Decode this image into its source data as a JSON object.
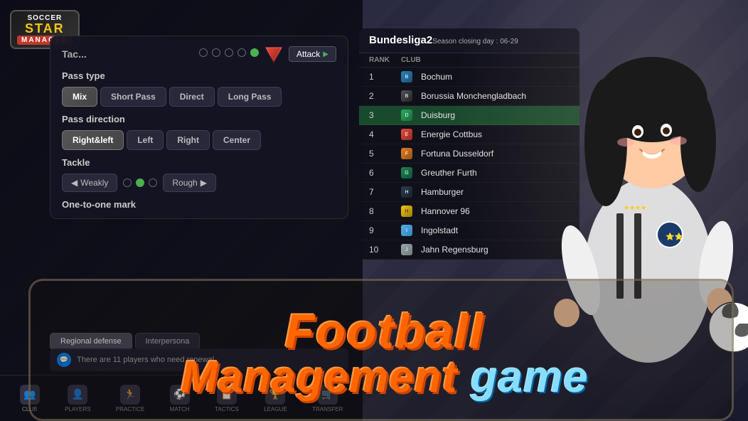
{
  "logo": {
    "line1": "SOCCER",
    "line2": "STAR",
    "line3": "MANAGER"
  },
  "tactics": {
    "title": "Tac...",
    "attack_label": "Attack",
    "pass_type_label": "Pass type",
    "pass_buttons": [
      "Mix",
      "Short Pass",
      "Direct",
      "Long Pass"
    ],
    "pass_direction_label": "Pass direction",
    "direction_buttons": [
      "Right&left",
      "Left",
      "Right",
      "Center"
    ],
    "tackle_label": "Tackle",
    "tackle_weakly": "Weakly",
    "tackle_rough": "Rough",
    "oneonone_label": "One-to-one mark"
  },
  "bottom_tabs": [
    "Regional defense",
    "Interpersona"
  ],
  "notification": "There are 11 players who need renewal.",
  "nav_items": [
    {
      "icon": "👥",
      "label": "CLUB"
    },
    {
      "icon": "👤",
      "label": "PLAYERS"
    },
    {
      "icon": "🏃",
      "label": "PRACTICE"
    },
    {
      "icon": "⚽",
      "label": "MATCH"
    },
    {
      "icon": "📋",
      "label": "TACTICS"
    },
    {
      "icon": "🏆",
      "label": "LEAGUE"
    },
    {
      "icon": "🛒",
      "label": "TRANSFER"
    }
  ],
  "league": {
    "title": "Bundesliga2",
    "subtitle": "Season closing day : 06-29",
    "cols": [
      "RANK",
      "CLUB"
    ],
    "teams": [
      {
        "rank": 1,
        "name": "Bochum",
        "badge_class": "badge-blue",
        "letter": "B"
      },
      {
        "rank": 2,
        "name": "Borussia Monchengladbach",
        "badge_class": "badge-black",
        "letter": "B"
      },
      {
        "rank": 3,
        "name": "Duisburg",
        "badge_class": "badge-green",
        "letter": "D",
        "highlighted": true
      },
      {
        "rank": 4,
        "name": "Energie Cottbus",
        "badge_class": "badge-red",
        "letter": "E"
      },
      {
        "rank": 5,
        "name": "Fortuna Dusseldorf",
        "badge_class": "badge-orange",
        "letter": "F"
      },
      {
        "rank": 6,
        "name": "Greuther Furth",
        "badge_class": "badge-darkgreen",
        "letter": "G"
      },
      {
        "rank": 7,
        "name": "Hamburger",
        "badge_class": "badge-navy",
        "letter": "H"
      },
      {
        "rank": 8,
        "name": "Hannover 96",
        "badge_class": "badge-yellow",
        "letter": "H"
      },
      {
        "rank": 9,
        "name": "Ingolstadt",
        "badge_class": "badge-lightblue",
        "letter": "I"
      },
      {
        "rank": 10,
        "name": "Jahn Regensburg",
        "badge_class": "badge-grey",
        "letter": "J"
      }
    ]
  },
  "footer": {
    "line1": "Football",
    "line2_part1": "Management ",
    "line2_part2": "game"
  }
}
